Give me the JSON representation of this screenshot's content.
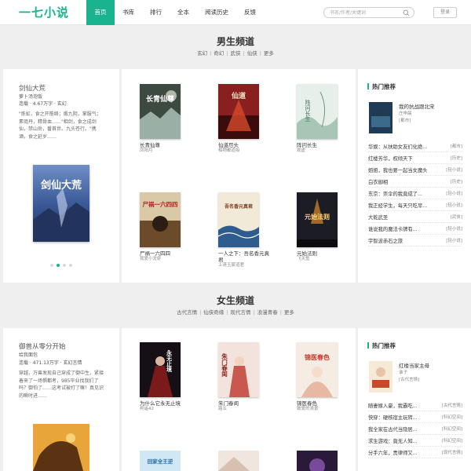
{
  "header": {
    "logo": "一七小说",
    "nav": [
      "首页",
      "书库",
      "排行",
      "全本",
      "阅读历史",
      "反馈"
    ],
    "search_placeholder": "书名/作者/关键词",
    "login": "登录",
    "accent": "#19b38f"
  },
  "male": {
    "title": "男生频道",
    "subcats": [
      "玄幻",
      "奇幻",
      "武侠",
      "仙侠",
      "更多"
    ],
    "featured": {
      "title": "剑仙大荒",
      "author": "萝卜汤泡饭",
      "meta": "连载 · 4.67万字 · 玄幻",
      "desc": "\"炼虹，食之开筋络；煅九阴，掌服气；素琏丹，精骨血……\"相剑，食之成剑仙，禁山岳，番首世。九头苍行。\"携酒，食之延岁……",
      "cover_text": "剑仙大荒"
    },
    "books": [
      {
        "title": "长青仙尊",
        "author": "凤阳月",
        "cover": "长青仙尊"
      },
      {
        "title": "仙道尽头",
        "author": "柏物都道吸",
        "cover": "仙道"
      },
      {
        "title": "阵问长生",
        "author": "观虚",
        "cover": "阵问长生"
      },
      {
        "title": "尸祸一六四四",
        "author": "我爱小龙虾",
        "cover": "尸祸一六四四"
      },
      {
        "title": "一人之下：吾名香元真君",
        "author": "上清玉宸道君",
        "cover": "吾名香元真君"
      },
      {
        "title": "元始法则",
        "author": "飞天鱼",
        "cover": "元始法则"
      }
    ],
    "hot": {
      "title": "热门推荐",
      "feature": {
        "title": "我的抗战跟北宋",
        "author": "庄申晨",
        "category": "[都市]"
      },
      "list": [
        {
          "t": "华娱：从扶助女友们化绝...",
          "c": "[都市]"
        },
        {
          "t": "红楼芳华，权倾天下",
          "c": "[历史]"
        },
        {
          "t": "姐姐，我也要一起当女魔头",
          "c": "[轻小说]"
        },
        {
          "t": "白衣御相",
          "c": "[历史]"
        },
        {
          "t": "东京：崇伞的我竟成了...",
          "c": "[轻小说]"
        },
        {
          "t": "我正经学生，每天只吃早...",
          "c": "[轻小说]"
        },
        {
          "t": "大乾武圣",
          "c": "[武侠]"
        },
        {
          "t": "谁说我的魔法卡牌有...",
          "c": "[轻小说]"
        },
        {
          "t": "宇智波赤石之旅",
          "c": "[轻小说]"
        }
      ]
    }
  },
  "female": {
    "title": "女生频道",
    "subcats": [
      "古代言情",
      "仙侠奇缘",
      "现代言情",
      "浪漫青春",
      "更多"
    ],
    "featured": {
      "title": "御兽从零分开始",
      "author": "给我面包",
      "meta": "连载 · 471.13万字 · 玄幻言情",
      "desc": "穿越，万兽发现自己穿成了御中生，紧接着来了一场惧都考，985毕业找我们了吗？御怕了……这考试被打了嘛！真见识的瞬时进……"
    },
    "books": [
      {
        "title": "为什么它永无止境",
        "author": "柯遥42",
        "cover": "永无止境"
      },
      {
        "title": "朱门春闺",
        "author": "路五",
        "cover": "朱门春闺"
      },
      {
        "title": "锦医春色",
        "author": "致爱的清景",
        "cover": "锦医春色"
      }
    ],
    "lower_covers": [
      "回家全王逆",
      "",
      ""
    ],
    "hot": {
      "title": "热门推荐",
      "feature": {
        "title": "红楼当家主母",
        "author": "谁子",
        "category": "[古代言情]"
      },
      "list": [
        {
          "t": "随妻嫁入豪，我霸吃...",
          "c": "[古代言情]"
        },
        {
          "t": "快穿：硬核宿主玩转...",
          "c": "[科幻空间]"
        },
        {
          "t": "我全家在古代当隐居...",
          "c": "[科幻空间]"
        },
        {
          "t": "求生游戏：竟无人知...",
          "c": "[科幻空间]"
        },
        {
          "t": "分手六年，贵律师又...",
          "c": "[现代言情]"
        }
      ]
    }
  }
}
